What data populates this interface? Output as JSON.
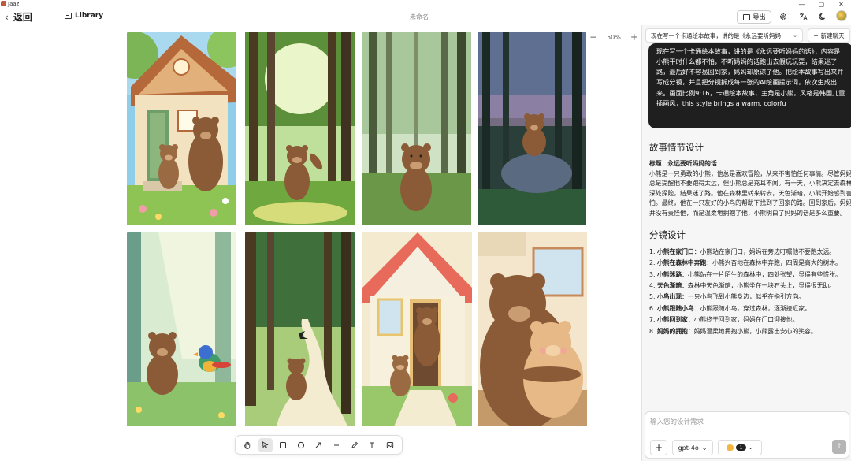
{
  "app": {
    "name": "Jaaz"
  },
  "window": {
    "minimize": "—",
    "maximize": "▢",
    "close": "✕"
  },
  "toolbar": {
    "back_label": "返回",
    "library_label": "Library",
    "doc_title": "未命名",
    "export_label": "导出"
  },
  "canvas": {
    "zoom": "50%",
    "zoom_out": "−",
    "zoom_in": "+"
  },
  "chat": {
    "session_title": "现在写一个卡通绘本故事，讲的是《永远要听妈妈",
    "new_chat_label": "新建聊天",
    "user_message": "现在写一个卡通绘本故事，讲的是《永远要听妈妈的话》，内容是小熊平时什么都不怕，不听妈妈的话跑出去假玩玩耍，结果迷了路，最后好不容易回到家，妈妈却原谅了他。把绘本故事写出来并写成分镜，并且把分镜拆成每一张的AI绘画提示词，依次生成出来。画面比例9:16，卡通绘本故事，主角是小熊，风格是韩国儿童插画风，this style brings a warm, colorfu",
    "section1_title": "故事情节设计",
    "story_title": "标题：永远要听妈妈的话",
    "story_body": "小熊是一只勇敢的小熊，他总是喜欢冒险，从来不害怕任何事情。尽管妈妈总是提醒他不要跑得太远，但小熊总是充耳不闻。有一天，小熊决定去森林深处探险，结果迷了路。他在森林里转来转去，天色渐暗，小熊开始感到害怕。最终，他在一只友好的小鸟的帮助下找到了回家的路。回到家后，妈妈并没有责怪他，而是温柔地拥抱了他，小熊明白了妈妈的话是多么重要。",
    "section2_title": "分镜设计",
    "storyboard": [
      {
        "num": "1.",
        "title": "小熊在家门口",
        "desc": "：小熊站在家门口，妈妈在旁边叮嘱他不要跑太远。"
      },
      {
        "num": "2.",
        "title": "小熊在森林中奔跑",
        "desc": "：小熊兴奋地在森林中奔跑，四周是高大的树木。"
      },
      {
        "num": "3.",
        "title": "小熊迷路",
        "desc": "：小熊站在一片陌生的森林中，四处张望，显得有些慌张。"
      },
      {
        "num": "4.",
        "title": "天色渐暗",
        "desc": "：森林中天色渐暗，小熊坐在一块石头上，显得很无助。"
      },
      {
        "num": "5.",
        "title": "小鸟出现",
        "desc": "：一只小鸟飞到小熊身边，似乎在指引方向。"
      },
      {
        "num": "6.",
        "title": "小熊跟随小鸟",
        "desc": "：小熊跟随小鸟，穿过森林，逐渐接近家。"
      },
      {
        "num": "7.",
        "title": "小熊回到家",
        "desc": "：小熊终于回到家，妈妈在门口迎接他。"
      },
      {
        "num": "8.",
        "title": "妈妈的拥抱",
        "desc": "：妈妈温柔地拥抱小熊，小熊露出安心的笑容。"
      }
    ],
    "input_placeholder": "输入您的设计需求",
    "model_label": "gpt-4o",
    "tool_count": "1",
    "send_icon": "↑",
    "plus": "+"
  },
  "icons": {
    "back": "back-arrow-icon",
    "library": "image-icon",
    "export": "image-export-icon",
    "settings": "gear-icon",
    "translate": "translate-icon",
    "theme": "moon-icon"
  }
}
